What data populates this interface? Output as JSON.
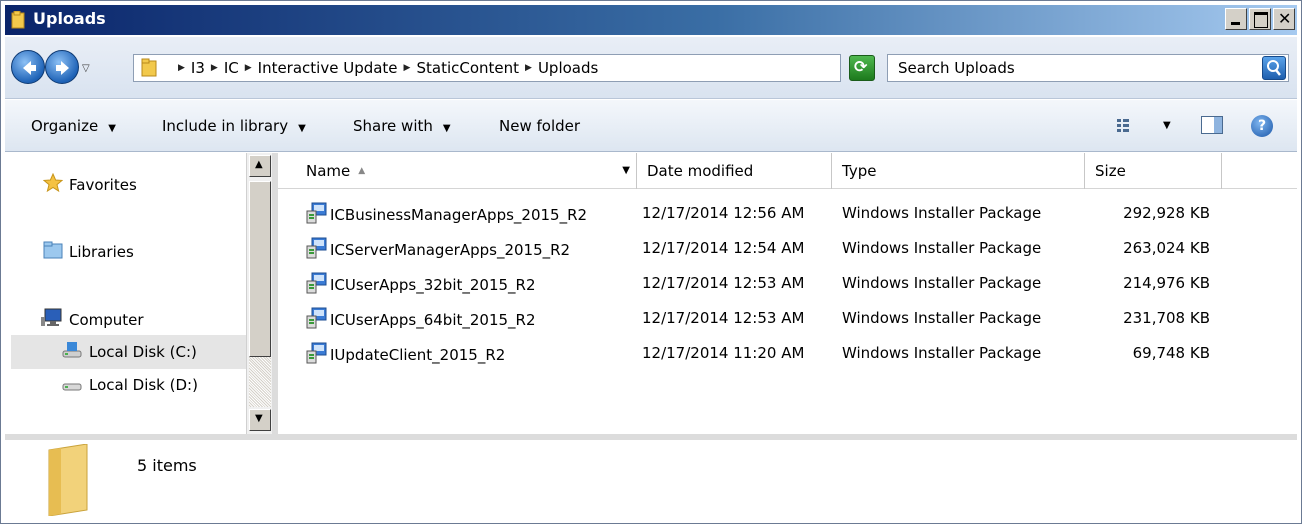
{
  "window": {
    "title": "Uploads"
  },
  "address": {
    "crumbs": [
      "I3",
      "IC",
      "Interactive Update",
      "StaticContent",
      "Uploads"
    ],
    "search_placeholder": "Search Uploads"
  },
  "toolbar": {
    "organize": "Organize",
    "include_in_library": "Include in library",
    "share_with": "Share with",
    "new_folder": "New folder"
  },
  "nav": {
    "favorites": "Favorites",
    "libraries": "Libraries",
    "computer": "Computer",
    "disk_c": "Local Disk (C:)",
    "disk_d": "Local Disk (D:)"
  },
  "columns": {
    "name": "Name",
    "date": "Date modified",
    "type": "Type",
    "size": "Size"
  },
  "files": [
    {
      "name": "ICBusinessManagerApps_2015_R2",
      "date": "12/17/2014 12:56 AM",
      "type": "Windows Installer Package",
      "size": "292,928 KB"
    },
    {
      "name": "ICServerManagerApps_2015_R2",
      "date": "12/17/2014 12:54 AM",
      "type": "Windows Installer Package",
      "size": "263,024 KB"
    },
    {
      "name": "ICUserApps_32bit_2015_R2",
      "date": "12/17/2014 12:53 AM",
      "type": "Windows Installer Package",
      "size": "214,976 KB"
    },
    {
      "name": "ICUserApps_64bit_2015_R2",
      "date": "12/17/2014 12:53 AM",
      "type": "Windows Installer Package",
      "size": "231,708 KB"
    },
    {
      "name": "IUpdateClient_2015_R2",
      "date": "12/17/2014 11:20 AM",
      "type": "Windows Installer Package",
      "size": "69,748 KB"
    }
  ],
  "status": {
    "item_count": "5 items"
  }
}
